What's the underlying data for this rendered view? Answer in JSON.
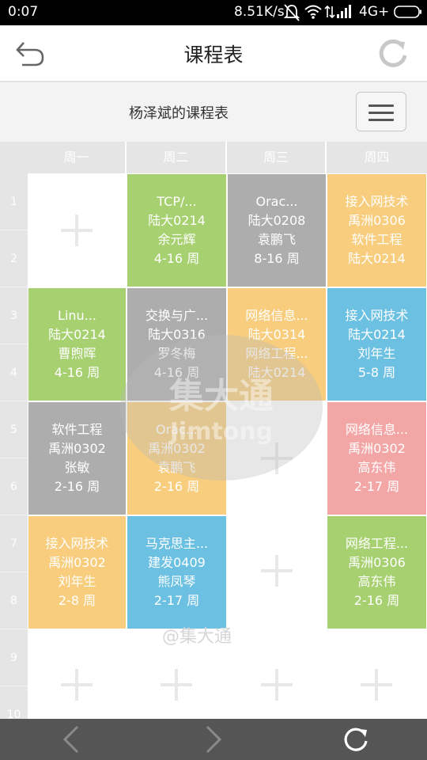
{
  "status_bar": {
    "time": "0:07",
    "network_speed": "8.51K/s",
    "network_type": "4G+",
    "icons": [
      "mute-icon",
      "wifi-icon",
      "signal-icon",
      "battery-icon"
    ]
  },
  "header": {
    "title": "课程表",
    "back_icon": "back-arrow-icon",
    "refresh_icon": "refresh-icon"
  },
  "subheader": {
    "schedule_name": "杨泽斌的课程表",
    "menu_icon": "hamburger-menu-icon"
  },
  "days": [
    "周一",
    "周二",
    "周三",
    "周四"
  ],
  "periods": [
    "1",
    "2",
    "3",
    "4",
    "5",
    "6",
    "7",
    "8",
    "9",
    "10"
  ],
  "courses": [
    {
      "day": 1,
      "start": 1,
      "span": 2,
      "color": "#a7d071",
      "lines": [
        "TCP/...",
        "陆大0214",
        "余元辉",
        "4-16 周"
      ]
    },
    {
      "day": 2,
      "start": 1,
      "span": 2,
      "color": "#adadad",
      "lines": [
        "Orac...",
        "陆大0208",
        "袁鹏飞",
        "8-16 周"
      ]
    },
    {
      "day": 3,
      "start": 1,
      "span": 2,
      "color": "#f8cd7d",
      "lines": [
        "接入网技术",
        "禹洲0306",
        "软件工程",
        "陆大0214"
      ]
    },
    {
      "day": 0,
      "start": 3,
      "span": 2,
      "color": "#a7d071",
      "lines": [
        "Linu...",
        "陆大0214",
        "曹煦晖",
        "4-16 周"
      ]
    },
    {
      "day": 1,
      "start": 3,
      "span": 2,
      "color": "#adadad",
      "lines": [
        "交换与广...",
        "陆大0316",
        "罗冬梅",
        "4-16 周"
      ]
    },
    {
      "day": 2,
      "start": 3,
      "span": 2,
      "color": "#f8cd7d",
      "lines": [
        "网络信息...",
        "陆大0314",
        "网络工程...",
        "陆大0214"
      ]
    },
    {
      "day": 3,
      "start": 3,
      "span": 2,
      "color": "#6cc1e3",
      "lines": [
        "接入网技术",
        "陆大0214",
        "刘年生",
        "5-8 周"
      ]
    },
    {
      "day": 0,
      "start": 5,
      "span": 2,
      "color": "#adadad",
      "lines": [
        "软件工程",
        "禹洲0302",
        "张敏",
        "2-16 周"
      ]
    },
    {
      "day": 1,
      "start": 5,
      "span": 2,
      "color": "#f8cd7d",
      "lines": [
        "Orac...",
        "禹洲0302",
        "袁鹏飞",
        "2-16 周"
      ]
    },
    {
      "day": 3,
      "start": 5,
      "span": 2,
      "color": "#f2a6a5",
      "lines": [
        "网络信息...",
        "禹洲0302",
        "高东伟",
        "2-17 周"
      ]
    },
    {
      "day": 0,
      "start": 7,
      "span": 2,
      "color": "#f8cd7d",
      "lines": [
        "接入网技术",
        "禹洲0302",
        "刘年生",
        "2-8 周"
      ]
    },
    {
      "day": 1,
      "start": 7,
      "span": 2,
      "color": "#6cc1e3",
      "lines": [
        "马克思主...",
        "建发0409",
        "熊凤琴",
        "2-17 周"
      ]
    },
    {
      "day": 3,
      "start": 7,
      "span": 2,
      "color": "#a7d071",
      "lines": [
        "网络工程...",
        "禹洲0306",
        "高东伟",
        "2-16 周"
      ]
    }
  ],
  "watermark": {
    "logo_text": "集大通",
    "logo_sub": "Jimtong",
    "handle": "@集大通"
  },
  "bottom_bar": {
    "icons": [
      "prev-arrow-icon",
      "next-arrow-icon",
      "reload-icon"
    ]
  }
}
